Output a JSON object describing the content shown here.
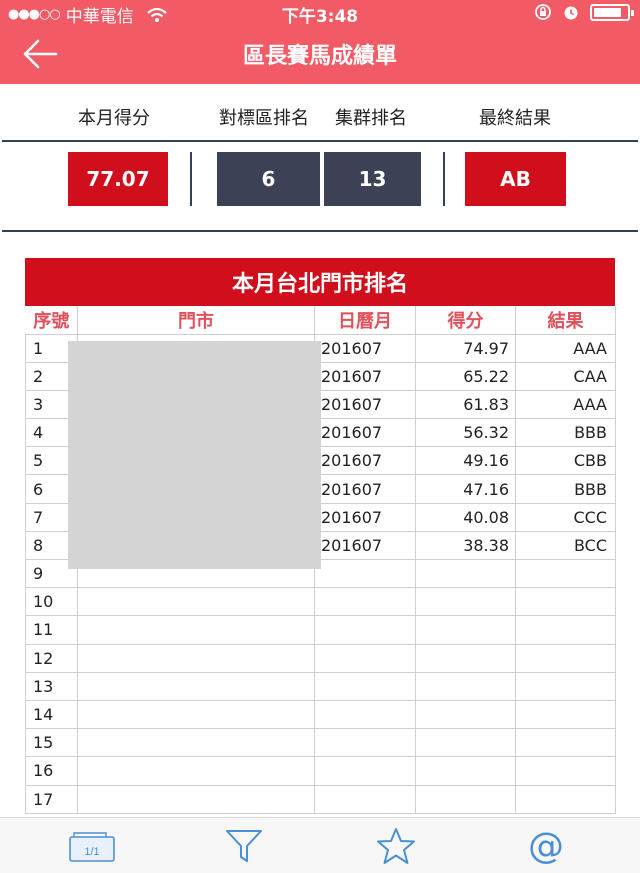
{
  "status_bar": {
    "signal": "●●●○○",
    "carrier": "中華電信",
    "time": "下午3:48",
    "battery_level": 0.85
  },
  "nav": {
    "title": "區長賽馬成績單",
    "back_icon": "arrow-left-icon"
  },
  "summary": {
    "labels": [
      "本月得分",
      "對標區排名",
      "集群排名",
      "最終結果"
    ],
    "values": {
      "score": "77.07",
      "benchmark_rank": "6",
      "cluster_rank": "13",
      "final_result": "AB"
    }
  },
  "ranking": {
    "title": "本月台北門市排名",
    "columns": [
      "序號",
      "門市",
      "日曆月",
      "得分",
      "結果"
    ],
    "rows": [
      {
        "seq": "1",
        "store": "",
        "month": "201607",
        "score": "74.97",
        "result": "AAA"
      },
      {
        "seq": "2",
        "store": "",
        "month": "201607",
        "score": "65.22",
        "result": "CAA"
      },
      {
        "seq": "3",
        "store": "",
        "month": "201607",
        "score": "61.83",
        "result": "AAA"
      },
      {
        "seq": "4",
        "store": "",
        "month": "201607",
        "score": "56.32",
        "result": "BBB"
      },
      {
        "seq": "5",
        "store": "",
        "month": "201607",
        "score": "49.16",
        "result": "CBB"
      },
      {
        "seq": "6",
        "store": "",
        "month": "201607",
        "score": "47.16",
        "result": "BBB"
      },
      {
        "seq": "7",
        "store": "",
        "month": "201607",
        "score": "40.08",
        "result": "CCC"
      },
      {
        "seq": "8",
        "store": "",
        "month": "201607",
        "score": "38.38",
        "result": "BCC"
      },
      {
        "seq": "9",
        "store": "",
        "month": "",
        "score": "",
        "result": ""
      },
      {
        "seq": "10",
        "store": "",
        "month": "",
        "score": "",
        "result": ""
      },
      {
        "seq": "11",
        "store": "",
        "month": "",
        "score": "",
        "result": ""
      },
      {
        "seq": "12",
        "store": "",
        "month": "",
        "score": "",
        "result": ""
      },
      {
        "seq": "13",
        "store": "",
        "month": "",
        "score": "",
        "result": ""
      },
      {
        "seq": "14",
        "store": "",
        "month": "",
        "score": "",
        "result": ""
      },
      {
        "seq": "15",
        "store": "",
        "month": "",
        "score": "",
        "result": ""
      },
      {
        "seq": "16",
        "store": "",
        "month": "",
        "score": "",
        "result": ""
      },
      {
        "seq": "17",
        "store": "",
        "month": "",
        "score": "",
        "result": ""
      }
    ]
  },
  "toolbar": {
    "page_indicator": "1/1",
    "icons": [
      "pages-icon",
      "filter-icon",
      "star-icon",
      "at-icon"
    ]
  },
  "colors": {
    "header": "#f25a66",
    "accent_red": "#d10f1c",
    "dark_box": "#3d4156",
    "column_header_text": "#e2505b",
    "toolbar_icon": "#4a8fd4"
  }
}
